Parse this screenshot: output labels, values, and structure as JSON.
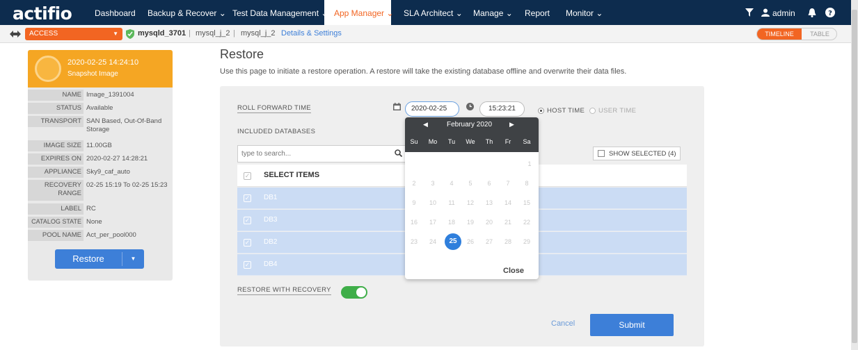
{
  "app": {
    "logo": "actifio",
    "nav": [
      "Dashboard",
      "Backup & Recover ⌄",
      "Test Data Management ⌄",
      "App Manager ⌄",
      "SLA Architect ⌄",
      "Manage ⌄",
      "Report",
      "Monitor ⌄"
    ],
    "user": "admin",
    "accent": "#f26522",
    "navbar_color": "#0d2c4e"
  },
  "subbar": {
    "access_label": "ACCESS",
    "db_name": "mysqld_3701",
    "crumb_1": "mysql_j_2",
    "crumb_2": "mysql_j_2",
    "details_link": "Details & Settings",
    "view_timeline": "TIMELINE",
    "view_table": "TABLE"
  },
  "snapshot": {
    "datetime": "2020-02-25  14:24:10",
    "type": "Snapshot Image",
    "props": [
      {
        "k": "NAME",
        "v": "Image_1391004"
      },
      {
        "k": "STATUS",
        "v": "Available"
      },
      {
        "k": "TRANSPORT",
        "v": "SAN Based, Out-Of-Band Storage"
      },
      {
        "k": "IMAGE SIZE",
        "v": "11.00GB"
      },
      {
        "k": "EXPIRES ON",
        "v": "2020-02-27 14:28:21"
      },
      {
        "k": "APPLIANCE",
        "v": "Sky9_caf_auto"
      },
      {
        "k": "RECOVERY RANGE",
        "v": "02-25 15:19 To 02-25 15:23"
      },
      {
        "k": "LABEL",
        "v": "RC"
      },
      {
        "k": "CATALOG STATE",
        "v": "None"
      },
      {
        "k": "POOL NAME",
        "v": "Act_per_pool000"
      }
    ],
    "restore_label": "Restore"
  },
  "restore": {
    "title": "Restore",
    "description": "Use this page to initiate a restore operation. A restore will take the existing database offline and overwrite their data files.",
    "roll_forward_label": "ROLL FORWARD TIME",
    "date_value": "2020-02-25",
    "time_value": "15:23:21",
    "host_time": "HOST TIME",
    "user_time": "USER TIME",
    "included_label": "INCLUDED DATABASES",
    "search_placeholder": "type to search...",
    "show_selected": "SHOW SELECTED (4)",
    "select_items": "SELECT ITEMS",
    "databases": [
      "DB1",
      "DB3",
      "DB2",
      "DB4"
    ],
    "restore_with_recovery": "RESTORE WITH RECOVERY",
    "recovery_enabled": true,
    "cancel_label": "Cancel",
    "submit_label": "Submit"
  },
  "calendar": {
    "month": "February 2020",
    "weekdays": [
      "Su",
      "Mo",
      "Tu",
      "We",
      "Th",
      "Fr",
      "Sa"
    ],
    "selected_day": "25",
    "close_label": "Close",
    "days_row1": [
      "1"
    ],
    "days_row2": [
      "2",
      "3",
      "4",
      "5",
      "6",
      "7",
      "8"
    ],
    "days_row3": [
      "9",
      "10",
      "11",
      "12",
      "13",
      "14",
      "15"
    ],
    "days_row4": [
      "16",
      "17",
      "18",
      "19",
      "20",
      "21",
      "22"
    ],
    "days_row5": [
      "23",
      "24",
      "25",
      "26",
      "27",
      "28",
      "29"
    ]
  }
}
